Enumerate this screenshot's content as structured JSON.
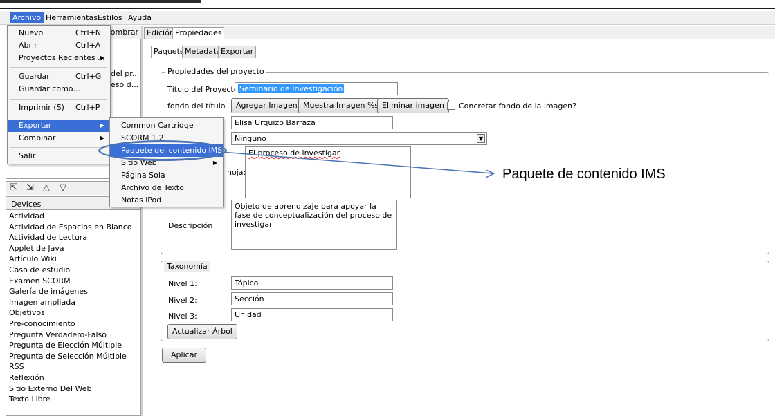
{
  "menubar": [
    "Archivo",
    "Herramientas",
    "Estilos",
    "Ayuda"
  ],
  "file_menu": {
    "items": [
      {
        "label": "Nuevo",
        "shortcut": "Ctrl+N"
      },
      {
        "label": "Abrir",
        "shortcut": "Ctrl+A"
      },
      {
        "label": "Proyectos Recientes ...",
        "shortcut": ""
      },
      {
        "label": "Guardar",
        "shortcut": "Ctrl+G"
      },
      {
        "label": "Guardar como...",
        "shortcut": ""
      },
      {
        "label": "Imprimir (S)",
        "shortcut": "Ctrl+P"
      },
      {
        "label": "Exportar",
        "shortcut": ""
      },
      {
        "label": "Combinar",
        "shortcut": ""
      },
      {
        "label": "Salir",
        "shortcut": ""
      }
    ]
  },
  "export_submenu": [
    "Common Cartridge",
    "SCORM 1.2",
    "Paquete del contenido IMS",
    "Sitio Web",
    "Página Sola",
    "Archivo de Texto",
    "Notas iPod"
  ],
  "outline": {
    "rename_label": "nombrar",
    "tree": [
      "del pr...",
      "eso d..."
    ]
  },
  "idevices": {
    "header": "iDevices",
    "items": [
      "Actividad",
      "Actividad de Espacios en Blanco",
      "Actividad de Lectura",
      "Applet de Java",
      "Artículo Wiki",
      "Caso de estudio",
      "Examen SCORM",
      "Galería de imágenes",
      "Imagen ampliada",
      "Objetivos",
      "Pre-conocimiento",
      "Pregunta Verdadero-Falso",
      "Pregunta de Elección Múltiple",
      "Pregunta de Selección Múltiple",
      "RSS",
      "Reflexión",
      "Sitio Externo Del Web",
      "Texto Libre"
    ]
  },
  "main_tabs": [
    "Edición",
    "Propiedades"
  ],
  "sub_tabs": [
    "Paquete",
    "Metadata",
    "Exportar"
  ],
  "project": {
    "legend": "Propiedades del proyecto",
    "title_label": "Título del Proyecto:",
    "title_value": "Seminario de Investigación",
    "bg_label": "fondo del título",
    "btn_add_image": "Agregar Imagen",
    "btn_show_image": "Muestra Imagen %s",
    "btn_remove_image": "Eliminar imagen",
    "chk_label": "Concretar fondo de la imagen?",
    "author_value": "Elisa Urquizo Barraza",
    "license_value": "Ninguno",
    "footer_label": "hoja:",
    "footer_value": "El proceso de investigar",
    "desc_label": "Descripción",
    "desc_value": "Objeto de aprendizaje para apoyar la fase de conceptualización del proceso de investigar"
  },
  "taxonomy": {
    "legend": "Taxonomía",
    "levels": [
      {
        "label": "Nivel 1:",
        "value": "Tópico"
      },
      {
        "label": "Nivel 2:",
        "value": "Sección"
      },
      {
        "label": "Nivel 3:",
        "value": "Unidad"
      }
    ],
    "update_btn": "Actualizar Árbol"
  },
  "apply_btn": "Aplicar",
  "annotation": "Paquete de contenido IMS"
}
